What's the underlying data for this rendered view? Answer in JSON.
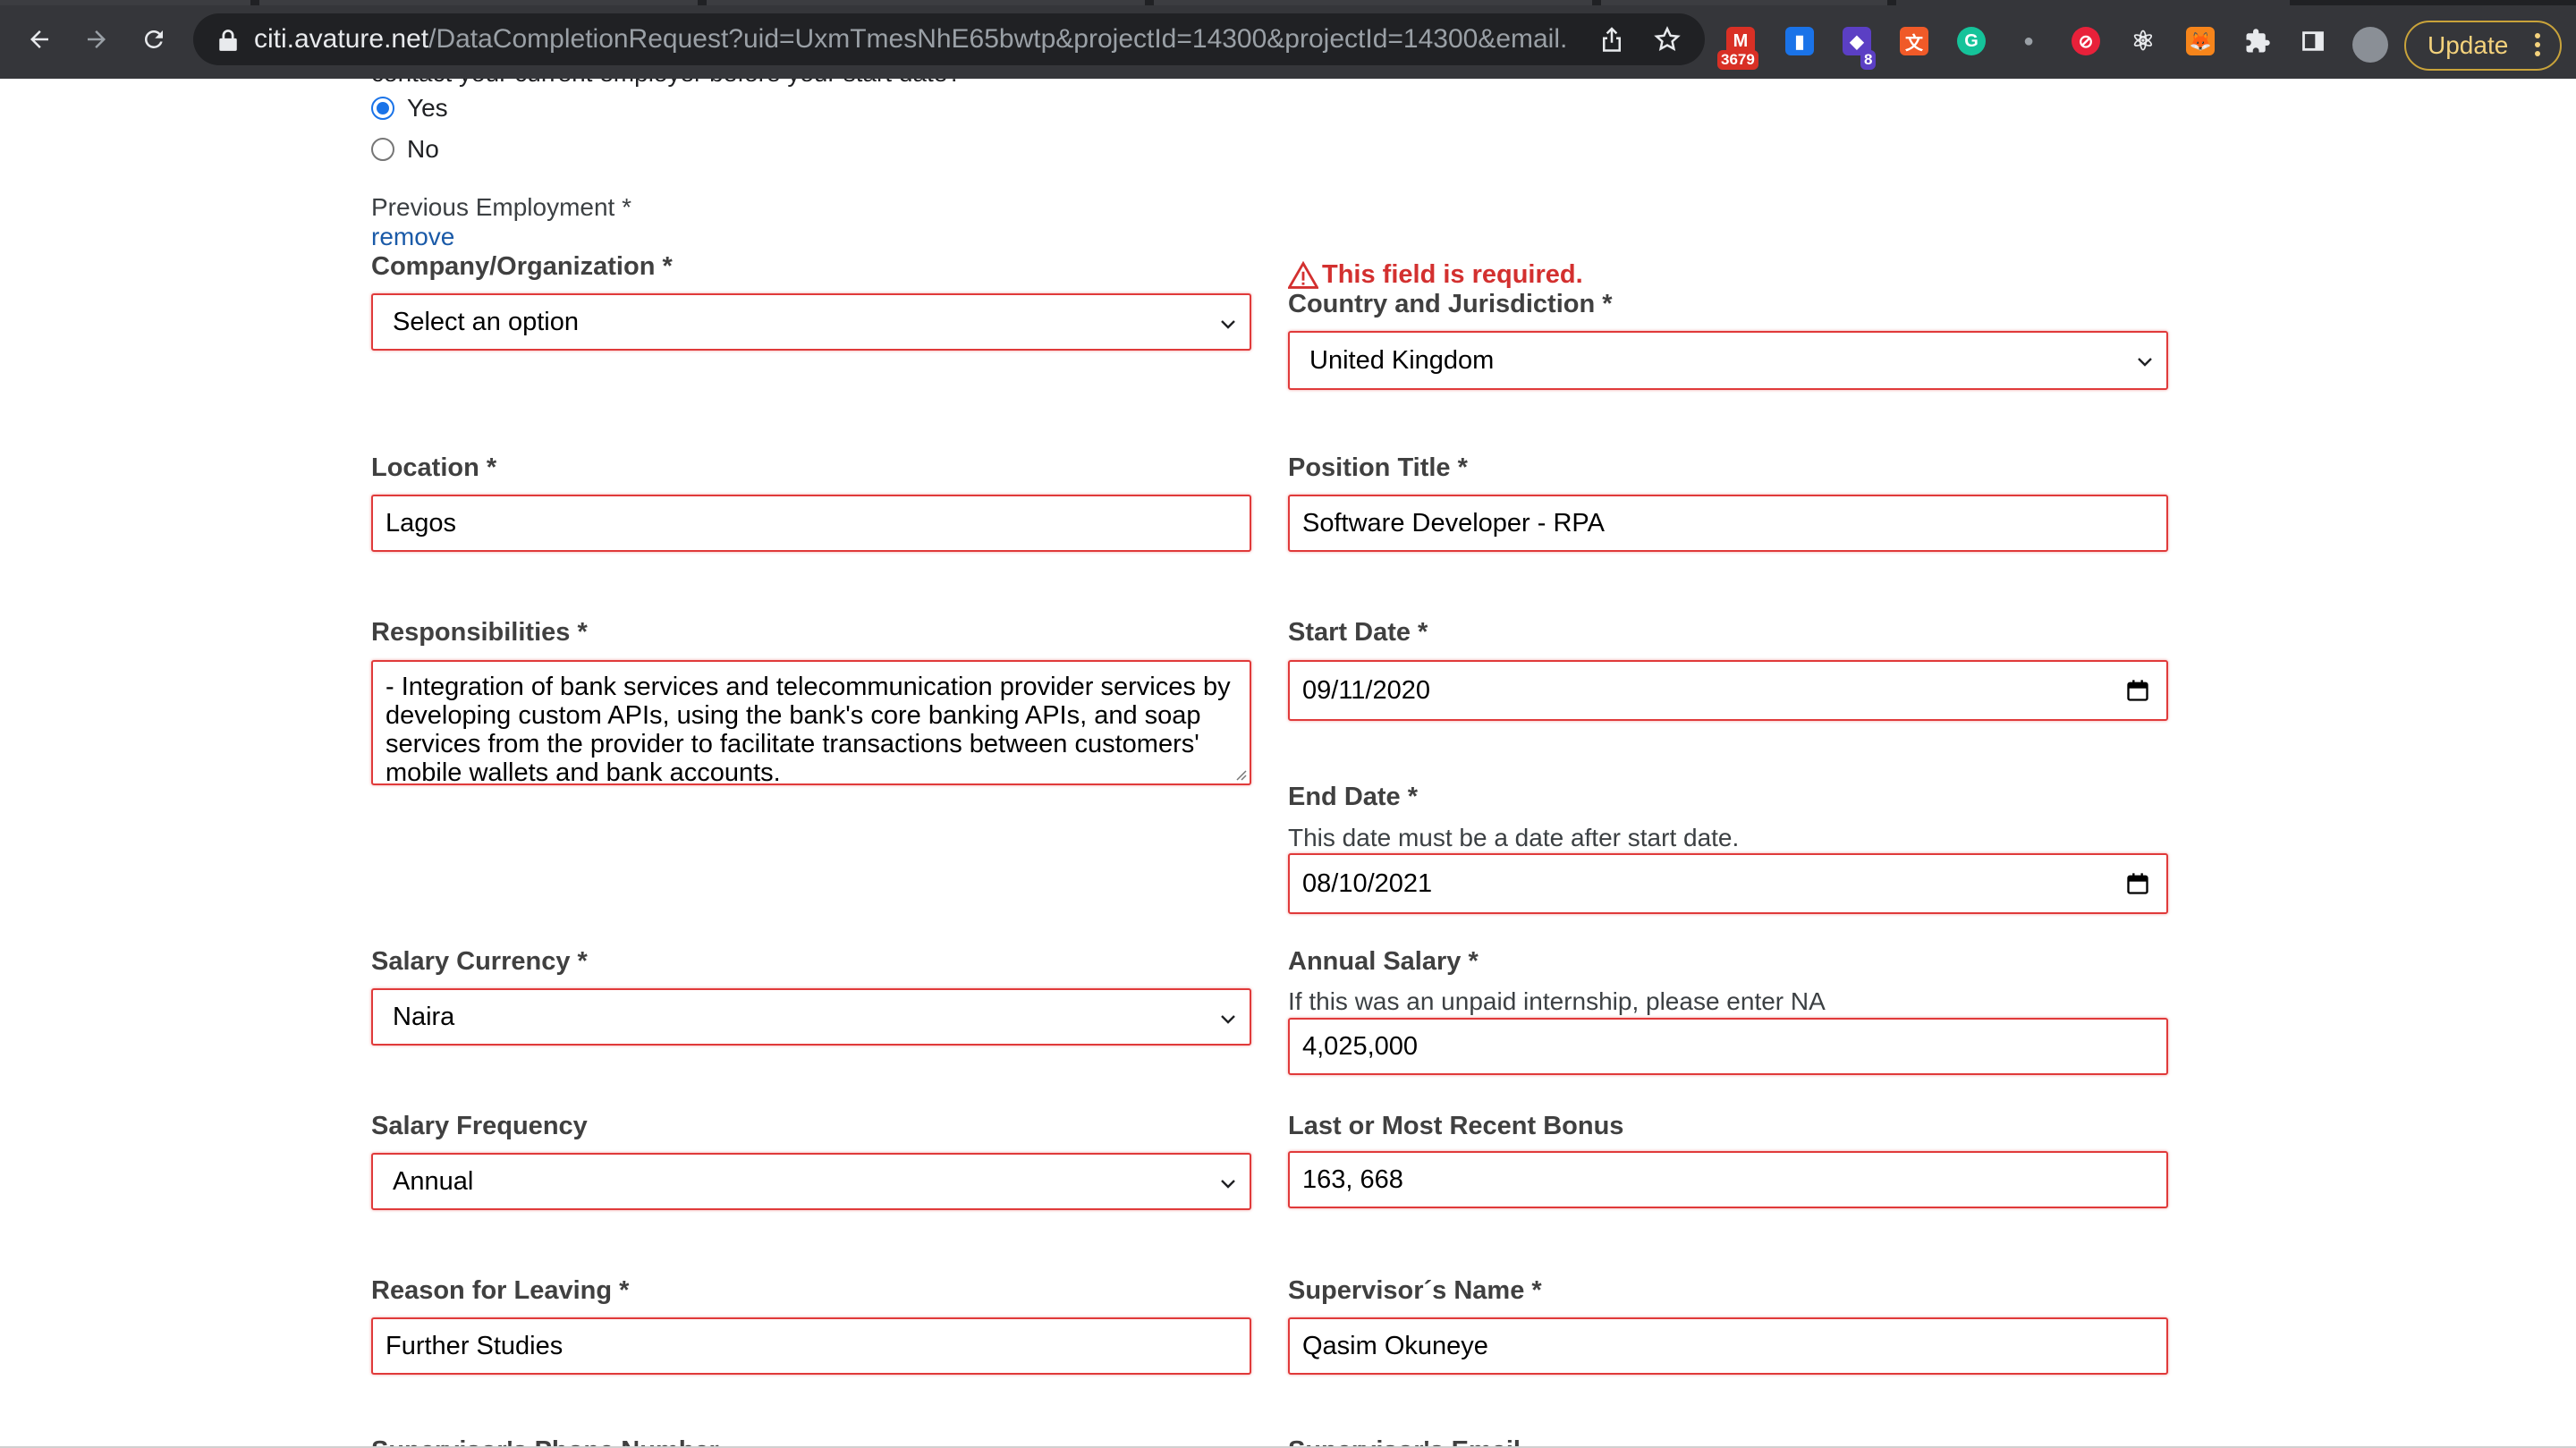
{
  "browser": {
    "url_host": "citi.avature.net",
    "url_path": "/DataCompletionRequest?uid=UxmTmesNhE65bwtp&projectId=14300&projectId=14300&email...",
    "update_label": "Update",
    "extensions": [
      {
        "name": "gmail-extension",
        "badge": "3679",
        "color": "#d93025"
      },
      {
        "name": "bookmark-extension",
        "badge": "",
        "color": "#1a73e8"
      },
      {
        "name": "stack-extension",
        "badge": "8",
        "color": "#5b3fc4"
      },
      {
        "name": "translate-extension",
        "badge": "",
        "color": "#f05a28"
      },
      {
        "name": "grammarly-extension",
        "badge": "",
        "color": "#15c39a"
      },
      {
        "name": "gray-extension",
        "badge": "",
        "color": "#9aa0a6"
      },
      {
        "name": "block-extension",
        "badge": "",
        "color": "#e8213a"
      },
      {
        "name": "react-devtools-extension",
        "badge": "",
        "color": "#e8eaed"
      },
      {
        "name": "metamask-extension",
        "badge": "",
        "color": "#f6851b"
      }
    ]
  },
  "form": {
    "cut_question": "contact your current employer before your start date?",
    "options": {
      "yes": "Yes",
      "no": "No"
    },
    "selected_option": "Yes",
    "previous_employment_title": "Previous Employment *",
    "remove_label": "remove",
    "error_message": "This field is required.",
    "company": {
      "label": "Company/Organization *",
      "value": "Select an option"
    },
    "country": {
      "label": "Country and Jurisdiction *",
      "value": "United Kingdom"
    },
    "location": {
      "label": "Location *",
      "value": "Lagos"
    },
    "position": {
      "label": "Position Title *",
      "value": "Software Developer - RPA"
    },
    "responsibilities": {
      "label": "Responsibilities *",
      "value": "- Integration of bank services and telecommunication provider services by developing custom APIs, using the bank's core banking APIs, and soap services from the provider to facilitate transactions between customers' mobile wallets and bank accounts."
    },
    "start_date": {
      "label": "Start Date *",
      "value": "09/11/2020"
    },
    "end_date": {
      "label": "End Date *",
      "hint": "This date must be a date after start date.",
      "value": "08/10/2021"
    },
    "salary_currency": {
      "label": "Salary Currency *",
      "value": "Naira"
    },
    "annual_salary": {
      "label": "Annual Salary *",
      "hint": "If this was an unpaid internship, please enter NA",
      "value": "4,025,000"
    },
    "salary_frequency": {
      "label": "Salary Frequency",
      "value": "Annual"
    },
    "bonus": {
      "label": "Last or Most Recent Bonus",
      "value": "163, 668"
    },
    "reason": {
      "label": "Reason for Leaving *",
      "value": "Further Studies"
    },
    "supervisor": {
      "label": "Supervisor´s Name *",
      "value": "Qasim Okuneye"
    },
    "next_left_label": "Supervisor's Phone Number",
    "next_right_label": "Supervisor's Email"
  }
}
